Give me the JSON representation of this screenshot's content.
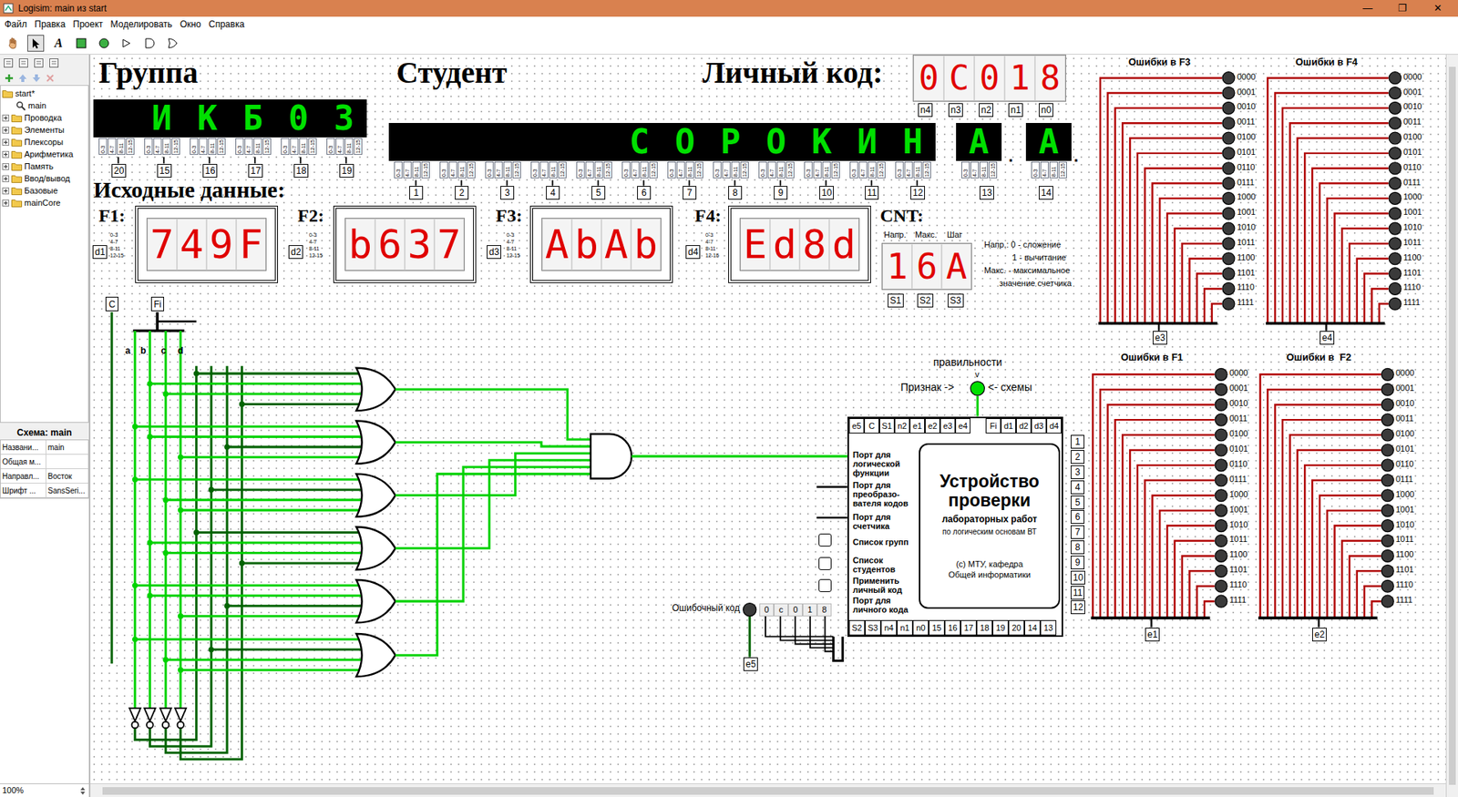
{
  "window": {
    "title": "Logisim: main из start",
    "controls": [
      "—",
      "❐",
      "✕"
    ]
  },
  "menu": [
    "Файл",
    "Правка",
    "Проект",
    "Моделировать",
    "Окно",
    "Справка"
  ],
  "toolbar": [
    {
      "kind": "hand",
      "selected": false
    },
    {
      "kind": "select",
      "selected": true
    },
    {
      "kind": "text",
      "label": "A",
      "selected": false
    },
    {
      "kind": "input",
      "selected": false
    },
    {
      "kind": "output",
      "selected": false
    },
    {
      "kind": "not",
      "selected": false
    },
    {
      "kind": "and",
      "selected": false
    },
    {
      "kind": "or",
      "selected": false
    }
  ],
  "explorer": [
    {
      "label": "start*",
      "kind": "project",
      "expanded": true
    },
    {
      "label": "main",
      "kind": "circuit",
      "expanded": false
    },
    {
      "label": "Проводка",
      "kind": "library",
      "expanded": false
    },
    {
      "label": "Элементы",
      "kind": "library",
      "expanded": false
    },
    {
      "label": "Плексоры",
      "kind": "library",
      "expanded": false
    },
    {
      "label": "Арифметика",
      "kind": "library",
      "expanded": false
    },
    {
      "label": "Память",
      "kind": "library",
      "expanded": false
    },
    {
      "label": "Ввод/вывод",
      "kind": "library",
      "expanded": false
    },
    {
      "label": "Базовые",
      "kind": "library",
      "expanded": false
    },
    {
      "label": "mainCore",
      "kind": "library",
      "expanded": false
    }
  ],
  "properties": {
    "title": "Схема: main",
    "rows": [
      {
        "name": "Названи...",
        "value": "main"
      },
      {
        "name": "Общая м...",
        "value": ""
      },
      {
        "name": "Направл...",
        "value": "Восток"
      },
      {
        "name": "Шрифт ...",
        "value": "SansSeri..."
      }
    ]
  },
  "zoom": "100%",
  "bit_labels": [
    "0-3",
    "4-7",
    "8-11",
    "12-15"
  ],
  "group": {
    "title": "Группа",
    "display": "ИКБ03",
    "ports": [
      "20",
      "15",
      "16",
      "17",
      "18",
      "19"
    ]
  },
  "student": {
    "title": "Студент",
    "surname": "СОРОКИН",
    "ports": [
      "1",
      "2",
      "3",
      "4",
      "5",
      "6",
      "7",
      "8",
      "9",
      "10",
      "11",
      "12"
    ],
    "initials": [
      {
        "letter": "А",
        "dot": ".",
        "port": "13"
      },
      {
        "letter": "А",
        "dot": ".",
        "port": "14"
      }
    ]
  },
  "code": {
    "title": "Личный код:",
    "digits": [
      "0",
      "C",
      "0",
      "1",
      "8"
    ],
    "ports": [
      "n4",
      "n3",
      "n2",
      "n1",
      "n0"
    ]
  },
  "inputs": {
    "title": "Исходные данные:",
    "functions": [
      {
        "label": "F1:",
        "value": "749F",
        "port": "d1"
      },
      {
        "label": "F2:",
        "value": "b637",
        "port": "d2"
      },
      {
        "label": "F3:",
        "value": "AbAb",
        "port": "d3"
      },
      {
        "label": "F4:",
        "value": "Ed8d",
        "port": "d4"
      }
    ]
  },
  "counter": {
    "label": "CNT:",
    "columns": [
      "Напр.",
      "Макс.",
      "Шаг"
    ],
    "digits": [
      "1",
      "6",
      "A"
    ],
    "ports": [
      "S1",
      "S2",
      "S3"
    ],
    "legend": [
      "Напр.: 0 - сложение",
      "1 - вычитание",
      "Макс. - максимальное",
      "значение счетчика"
    ]
  },
  "error_panels": [
    {
      "title": "Ошибки в F3",
      "port": "e3",
      "lit": false,
      "codes": [
        "0000",
        "0001",
        "0010",
        "0011",
        "0100",
        "0101",
        "0110",
        "0111",
        "1000",
        "1001",
        "1010",
        "1011",
        "1100",
        "1101",
        "1110",
        "1111"
      ]
    },
    {
      "title": "Ошибки в F4",
      "port": "e4",
      "lit": false,
      "codes": [
        "0000",
        "0001",
        "0010",
        "0011",
        "0100",
        "0101",
        "0110",
        "0111",
        "1000",
        "1001",
        "1010",
        "1011",
        "1100",
        "1101",
        "1110",
        "1111"
      ]
    },
    {
      "title": "Ошибки в F1",
      "port": "e1",
      "lit": false,
      "codes": [
        "0000",
        "0001",
        "0010",
        "0011",
        "0100",
        "0101",
        "0110",
        "0111",
        "1000",
        "1001",
        "1010",
        "1011",
        "1100",
        "1101",
        "1110",
        "1111"
      ]
    },
    {
      "title": "Ошибки в  F2",
      "port": "e2",
      "lit": false,
      "codes": [
        "0000",
        "0001",
        "0010",
        "0011",
        "0100",
        "0101",
        "0110",
        "0111",
        "1000",
        "1001",
        "1010",
        "1011",
        "1100",
        "1101",
        "1110",
        "1111"
      ]
    }
  ],
  "indicator": {
    "caption": "правильности",
    "arrow": "v",
    "left": "Признак ->",
    "right": "<- схемы",
    "on": true
  },
  "checker": {
    "title": [
      "Устройство",
      "проверки"
    ],
    "subtitle": "лабораторных работ",
    "course": "по логическим основам ВТ",
    "copyright": [
      "(c) МТУ, кафедра",
      "Общей информатики"
    ],
    "top_ports_left": [
      "e5",
      "C",
      "S1",
      "n2",
      "e1",
      "e2",
      "e3",
      "e4"
    ],
    "top_ports_right": [
      "Fi",
      "d1",
      "d2",
      "d3",
      "d4"
    ],
    "right_ports": [
      "1",
      "2",
      "3",
      "4",
      "5",
      "6",
      "7",
      "8",
      "9",
      "10",
      "11",
      "12"
    ],
    "bottom_ports": [
      "S2",
      "S3",
      "n4",
      "n1",
      "n0",
      "15",
      "16",
      "17",
      "18",
      "19",
      "20",
      "14",
      "13"
    ],
    "labels": [
      {
        "lines": [
          "Порт для",
          "логической",
          "функции"
        ],
        "kind": "port",
        "checked": false
      },
      {
        "lines": [
          "Порт для",
          "преобразо-",
          "вателя кодов"
        ],
        "kind": "port",
        "checked": false
      },
      {
        "lines": [
          "Порт для",
          "счетчика"
        ],
        "kind": "port",
        "checked": false
      },
      {
        "lines": [
          "Список групп"
        ],
        "kind": "button",
        "checked": false
      },
      {
        "lines": [
          "Список",
          "студентов"
        ],
        "kind": "button",
        "checked": false
      },
      {
        "lines": [
          "Применить",
          "личный код"
        ],
        "kind": "button",
        "checked": false
      },
      {
        "lines": [
          "Порт для",
          "личного кода"
        ],
        "kind": "port",
        "checked": false
      }
    ]
  },
  "error_code": {
    "label": "Ошибочный код",
    "digits": [
      "0",
      "c",
      "0",
      "1",
      "8"
    ],
    "port": "e5",
    "on": false
  },
  "circuit": {
    "pins": [
      {
        "label": "C",
        "value": 0
      },
      {
        "label": "Fi",
        "value": 1
      }
    ],
    "variables": [
      {
        "name": "a",
        "value": 1
      },
      {
        "name": "b",
        "value": 1
      },
      {
        "name": "c",
        "value": 1
      },
      {
        "name": "d",
        "value": 1
      }
    ]
  }
}
